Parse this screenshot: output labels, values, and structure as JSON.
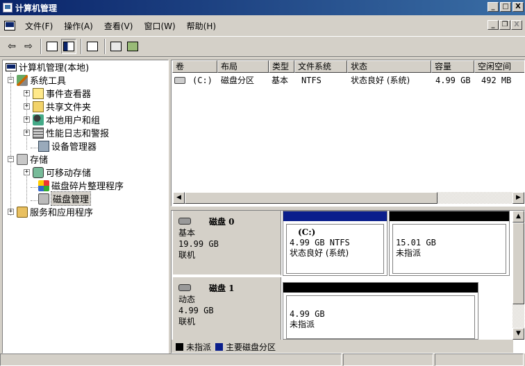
{
  "window": {
    "title": "计算机管理",
    "minimize": "_",
    "maximize": "□",
    "close": "X"
  },
  "menu": {
    "items": [
      "文件(F)",
      "操作(A)",
      "查看(V)",
      "窗口(W)",
      "帮助(H)"
    ],
    "mdi_minimize": "_",
    "mdi_restore": "❐",
    "mdi_close": "X"
  },
  "toolbar": {
    "back": "⇦",
    "forward": "⇨"
  },
  "tree": {
    "root": "计算机管理(本地)",
    "system_tools": "系统工具",
    "event_viewer": "事件查看器",
    "shared_folders": "共享文件夹",
    "local_users": "本地用户和组",
    "perf_logs": "性能日志和警报",
    "device_manager": "设备管理器",
    "storage": "存储",
    "removable_storage": "可移动存储",
    "defrag": "磁盘碎片整理程序",
    "disk_management": "磁盘管理",
    "services_apps": "服务和应用程序",
    "expand": "+",
    "collapse": "−"
  },
  "volumes": {
    "columns": [
      "卷",
      "布局",
      "类型",
      "文件系统",
      "状态",
      "容量",
      "空闲空间"
    ],
    "rows": [
      {
        "volume": "(C:)",
        "layout": "磁盘分区",
        "type": "基本",
        "fs": "NTFS",
        "status": "状态良好 (系统)",
        "capacity": "4.99 GB",
        "free": "492 MB"
      }
    ]
  },
  "disks": [
    {
      "name": "磁盘 0",
      "type": "基本",
      "size": "19.99 GB",
      "state": "联机",
      "partitions": [
        {
          "label": "(C:)",
          "size_fs": "4.99 GB NTFS",
          "status": "状态良好 (系统)",
          "bar_color": "#0a1e8c"
        },
        {
          "size": "15.01 GB",
          "status": "未指派",
          "bar_color": "#000000"
        }
      ]
    },
    {
      "name": "磁盘 1",
      "type": "动态",
      "size": "4.99 GB",
      "state": "联机",
      "partitions": [
        {
          "size": "4.99 GB",
          "status": "未指派",
          "bar_color": "#000000"
        }
      ]
    }
  ],
  "legend": [
    {
      "label": "未指派",
      "color": "#000000"
    },
    {
      "label": "主要磁盘分区",
      "color": "#0a1e8c"
    }
  ],
  "scroll": {
    "left": "◀",
    "right": "▶",
    "up": "▲",
    "down": "▼"
  }
}
